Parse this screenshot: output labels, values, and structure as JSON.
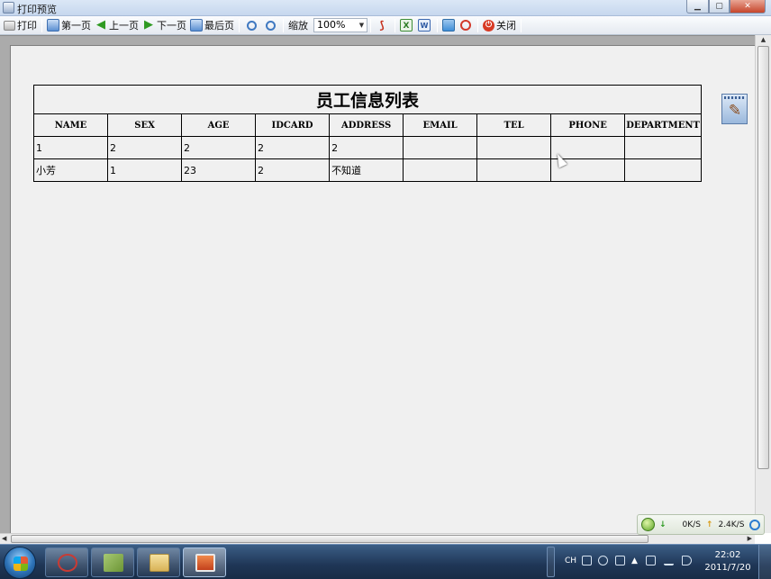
{
  "window": {
    "title": "打印预览"
  },
  "toolbar": {
    "print": "打印",
    "first_page": "第一页",
    "prev_page": "上一页",
    "next_page": "下一页",
    "last_page": "最后页",
    "zoom_label": "缩放",
    "zoom_value": "100%",
    "close": "关闭"
  },
  "report": {
    "title": "员工信息列表",
    "columns": [
      "NAME",
      "SEX",
      "AGE",
      "IDCARD",
      "ADDRESS",
      "EMAIL",
      "TEL",
      "PHONE",
      "DEPARTMENT"
    ],
    "rows": [
      [
        "1",
        "2",
        "2",
        "2",
        "2",
        "",
        "",
        "",
        ""
      ],
      [
        "小芳",
        "1",
        "23",
        "2",
        "不知道",
        "",
        "",
        "",
        ""
      ]
    ]
  },
  "netspeed": {
    "down": "0K/S",
    "up": "2.4K/S"
  },
  "tray": {
    "lang": "CH"
  },
  "clock": {
    "time": "22:02",
    "date": "2011/7/20"
  },
  "colors": {
    "paper": "#f0f0f0",
    "preview_bg": "#ababab",
    "taskbar": "#1f3656"
  }
}
